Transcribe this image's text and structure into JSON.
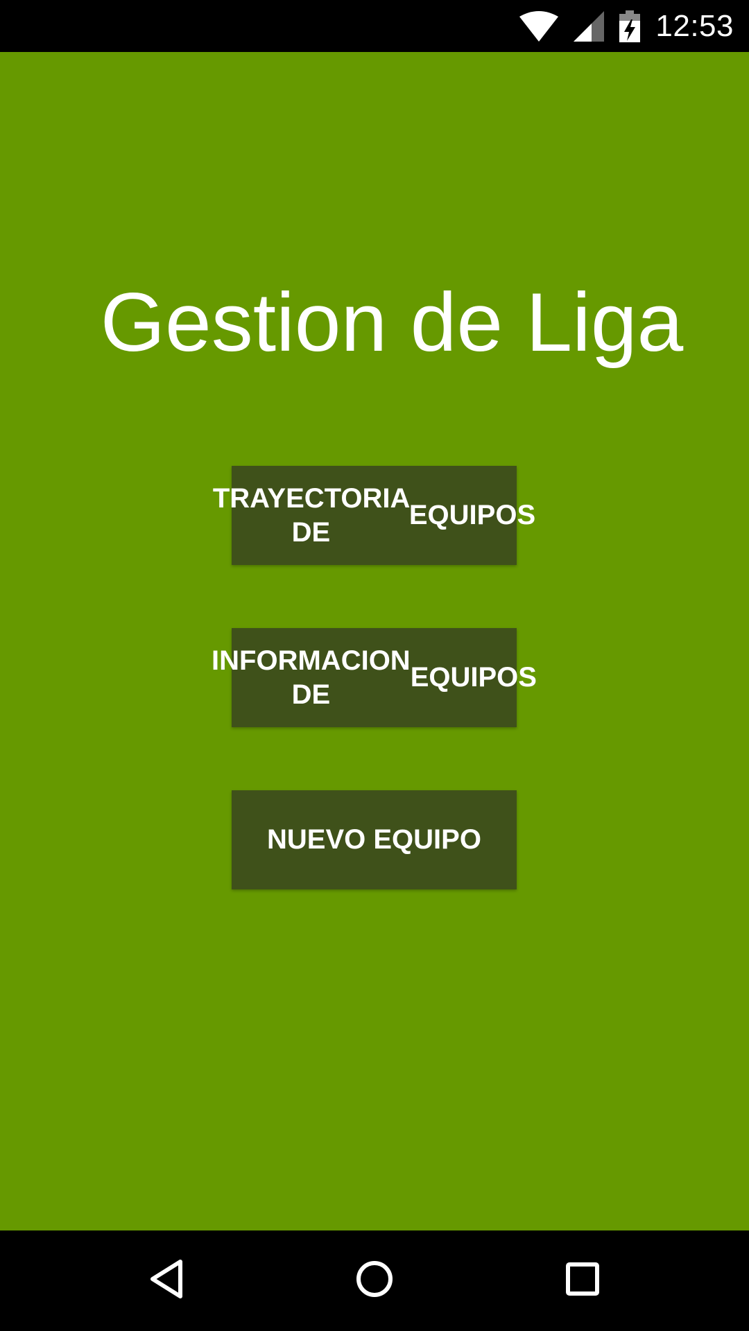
{
  "status_bar": {
    "time": "12:53",
    "icons": [
      "wifi-icon",
      "cell-signal-icon",
      "battery-charging-icon"
    ]
  },
  "app": {
    "title": "Gestion de Liga",
    "background_color": "#669900",
    "button_color": "#3f511a"
  },
  "buttons": [
    {
      "line1": "TRAYECTORIA DE",
      "line2": "EQUIPOS"
    },
    {
      "line1": "INFORMACION DE",
      "line2": "EQUIPOS"
    },
    {
      "line1": "NUEVO EQUIPO"
    }
  ],
  "nav_bar": {
    "icons": [
      "back-icon",
      "home-icon",
      "recents-icon"
    ]
  }
}
